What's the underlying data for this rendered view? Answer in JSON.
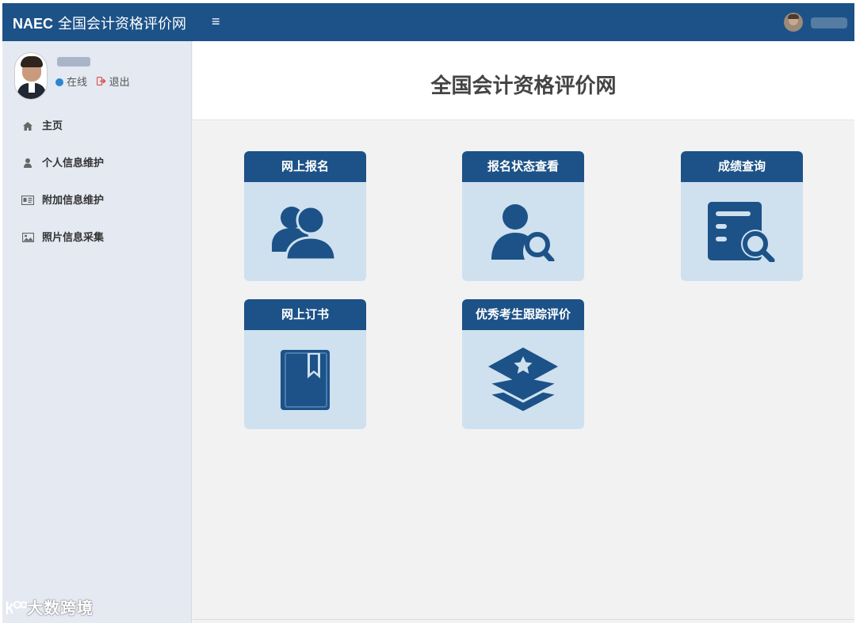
{
  "topbar": {
    "brand_strong": "NAEC",
    "brand_text": "全国会计资格评价网",
    "menu_toggle": "≡"
  },
  "sidebar": {
    "status_online": "在线",
    "logout": "退出",
    "items": [
      {
        "label": "主页",
        "icon": "home-icon"
      },
      {
        "label": "个人信息维护",
        "icon": "user-icon"
      },
      {
        "label": "附加信息维护",
        "icon": "id-card-icon"
      },
      {
        "label": "照片信息采集",
        "icon": "image-icon"
      }
    ]
  },
  "main": {
    "title": "全国会计资格评价网",
    "cards": [
      {
        "label": "网上报名",
        "icon": "users-icon"
      },
      {
        "label": "报名状态查看",
        "icon": "user-search-icon"
      },
      {
        "label": "成绩查询",
        "icon": "document-search-icon"
      },
      {
        "label": "网上订书",
        "icon": "book-icon"
      },
      {
        "label": "优秀考生跟踪评价",
        "icon": "layers-star-icon"
      }
    ]
  },
  "watermark": "大数跨境",
  "colors": {
    "primary": "#1c5287",
    "card_bg": "#cfe0ef",
    "sidebar_bg": "#e4e9f2",
    "content_bg": "#f2f2f2",
    "status_online": "#2a86d1",
    "logout": "#d9534f"
  }
}
